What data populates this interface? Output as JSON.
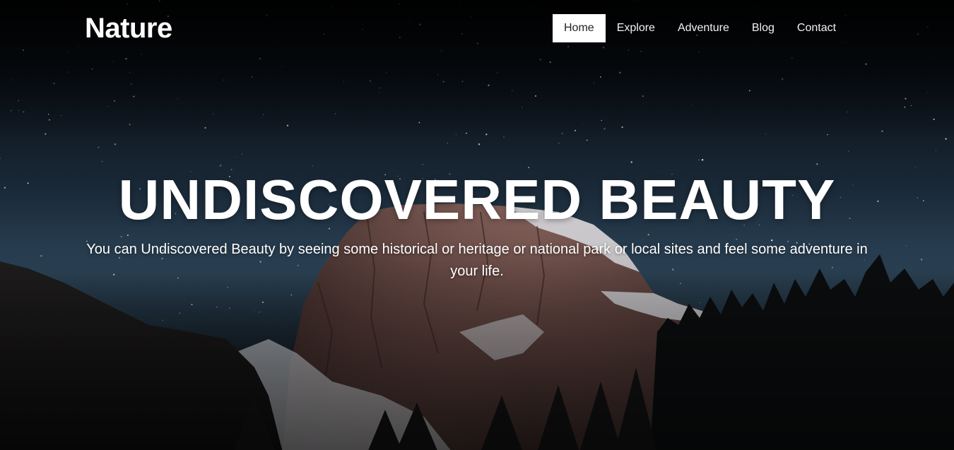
{
  "brand": {
    "logo_text": "Nature"
  },
  "nav": {
    "items": [
      {
        "label": "Home",
        "active": true
      },
      {
        "label": "Explore",
        "active": false
      },
      {
        "label": "Adventure",
        "active": false
      },
      {
        "label": "Blog",
        "active": false
      },
      {
        "label": "Contact",
        "active": false
      }
    ]
  },
  "hero": {
    "title": "UNDISCOVERED BEAUTY",
    "subtitle": "You can Undiscovered Beauty by seeing some historical or heritage or national park or local sites and feel some adventure in your life."
  },
  "colors": {
    "text": "#ffffff",
    "active_nav_bg": "#ffffff",
    "active_nav_text": "#222222",
    "sky_dark": "#04060a",
    "sky_mid": "#2b4356"
  }
}
